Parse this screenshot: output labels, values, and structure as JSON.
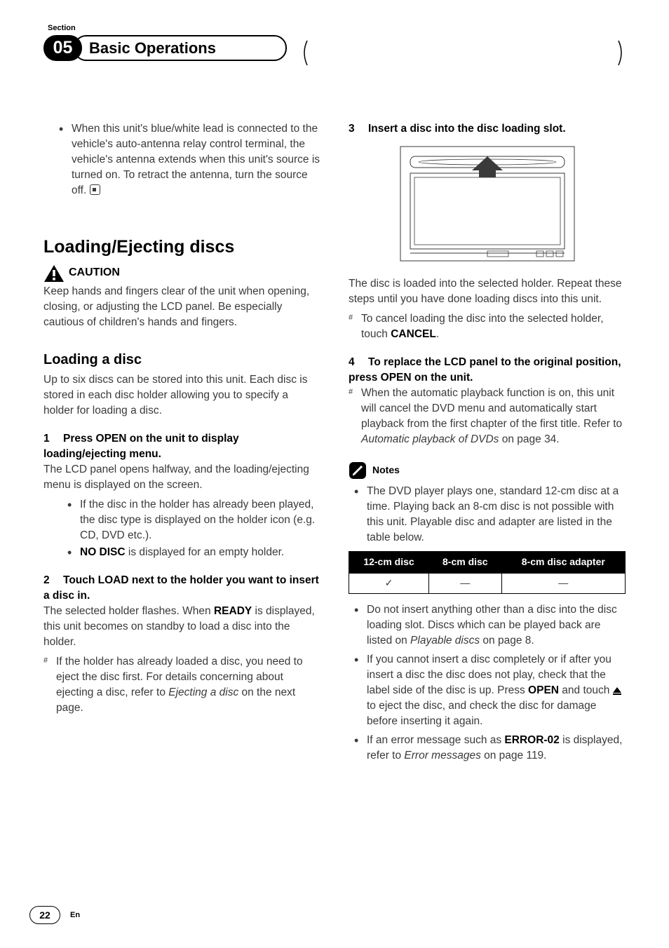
{
  "header": {
    "section_label": "Section",
    "section_number": "05",
    "chapter_title": "Basic Operations"
  },
  "left": {
    "top_bullet": "When this unit's blue/white lead is connected to the vehicle's auto-antenna relay control terminal, the vehicle's antenna extends when this unit's source is turned on. To retract the antenna, turn the source off.",
    "h1": "Loading/Ejecting discs",
    "caution_label": "CAUTION",
    "caution_body": "Keep hands and fingers clear of the unit when opening, closing, or adjusting the LCD panel. Be especially cautious of children's hands and fingers.",
    "h2": "Loading a disc",
    "intro": "Up to six discs can be stored into this unit. Each disc is stored in each disc holder allowing you to specify a holder for loading a disc.",
    "step1_lead_num": "1",
    "step1_lead": "Press OPEN on the unit to display loading/ejecting menu.",
    "step1_body": "The LCD panel opens halfway, and the loading/ejecting menu is displayed on the screen.",
    "step1_b1": "If the disc in the holder has already been played, the disc type is displayed on the holder icon (e.g. CD, DVD etc.).",
    "step1_b2_pre": "NO DISC",
    "step1_b2_post": " is displayed for an empty holder.",
    "step2_lead_num": "2",
    "step2_lead": "Touch LOAD next to the holder you want to insert a disc in.",
    "step2_body_pre": "The selected holder flashes. When ",
    "step2_body_mid": "READY",
    "step2_body_post": " is displayed, this unit becomes on standby to load a disc into the holder.",
    "step2_note_pre": "If the holder has already loaded a disc, you need to eject the disc first. For details concerning about ejecting a disc, refer to ",
    "step2_note_ital": "Ejecting a disc",
    "step2_note_post": " on the next page."
  },
  "right": {
    "step3_lead_num": "3",
    "step3_lead": "Insert a disc into the disc loading slot.",
    "after_img": "The disc is loaded into the selected holder. Repeat these steps until you have done loading discs into this unit.",
    "cancel_pre": "To cancel loading the disc into the selected holder, touch ",
    "cancel_bold": "CANCEL",
    "cancel_post": ".",
    "step4_lead_num": "4",
    "step4_lead": "To replace the LCD panel to the original position, press OPEN on the unit.",
    "step4_note_pre": "When the automatic playback function is on, this unit will cancel the DVD menu and automatically start playback from the first chapter of the first title. Refer to ",
    "step4_note_ital": "Automatic playback of DVDs",
    "step4_note_post": " on page 34.",
    "notes_label": "Notes",
    "nb1": "The DVD player plays one, standard 12-cm disc at a time. Playing back an 8-cm disc is not possible with this unit. Playable disc and adapter are listed in the table below.",
    "table": {
      "h1": "12-cm disc",
      "h2": "8-cm disc",
      "h3": "8-cm disc adapter",
      "c1": "✓",
      "c2": "—",
      "c3": "—"
    },
    "nb2_pre": "Do not insert anything other than a disc into the disc loading slot. Discs which can be played back are listed on ",
    "nb2_ital": "Playable discs",
    "nb2_post": " on page 8.",
    "nb3_pre": "If you cannot insert a disc completely or if after you insert a disc the disc does not play, check that the label side of the disc is up. Press ",
    "nb3_bold": "OPEN",
    "nb3_mid": " and touch ",
    "nb3_post": " to eject the disc, and check the disc for damage before inserting it again.",
    "nb4_pre": "If an error message such as ",
    "nb4_bold": "ERROR-02",
    "nb4_mid": " is displayed, refer to ",
    "nb4_ital": "Error messages",
    "nb4_post": " on page 119."
  },
  "footer": {
    "page": "22",
    "lang": "En"
  }
}
